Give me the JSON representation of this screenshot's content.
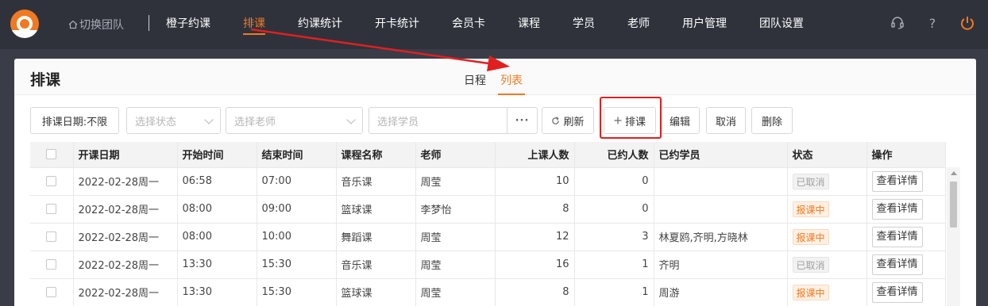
{
  "topbar": {
    "switch_team_label": "切换团队",
    "nav": [
      {
        "label": "橙子约课",
        "active": false
      },
      {
        "label": "排课",
        "active": true
      },
      {
        "label": "约课统计",
        "active": false
      },
      {
        "label": "开卡统计",
        "active": false
      },
      {
        "label": "会员卡",
        "active": false
      },
      {
        "label": "课程",
        "active": false
      },
      {
        "label": "学员",
        "active": false
      },
      {
        "label": "老师",
        "active": false
      },
      {
        "label": "用户管理",
        "active": false
      },
      {
        "label": "团队设置",
        "active": false
      }
    ],
    "icons": [
      "headset-icon",
      "help-icon",
      "power-icon"
    ],
    "help_glyph": "?"
  },
  "page": {
    "title": "排课",
    "view_tabs": [
      {
        "label": "日程",
        "active": false
      },
      {
        "label": "列表",
        "active": true
      }
    ]
  },
  "toolbar": {
    "date_filter": "排课日期:不限",
    "status_placeholder": "选择状态",
    "teacher_placeholder": "选择老师",
    "student_placeholder": "选择学员",
    "ellipsis": "···",
    "refresh_label": "刷新",
    "add_label": "排课",
    "edit_label": "编辑",
    "cancel_label": "取消",
    "delete_label": "删除"
  },
  "table": {
    "columns": [
      "开课日期",
      "开始时间",
      "结束时间",
      "课程名称",
      "老师",
      "上课人数",
      "已约人数",
      "已约学员",
      "状态",
      "操作"
    ],
    "rows": [
      {
        "date": "2022-02-28周一",
        "start": "06:58",
        "end": "07:00",
        "course": "音乐课",
        "teacher": "周莹",
        "capacity": "10",
        "booked": "0",
        "students": "",
        "status": "已取消",
        "status_type": "cancelled",
        "action": "查看详情"
      },
      {
        "date": "2022-02-28周一",
        "start": "08:00",
        "end": "09:00",
        "course": "篮球课",
        "teacher": "李梦怡",
        "capacity": "8",
        "booked": "0",
        "students": "",
        "status": "报课中",
        "status_type": "open",
        "action": "查看详情"
      },
      {
        "date": "2022-02-28周一",
        "start": "08:00",
        "end": "10:00",
        "course": "舞蹈课",
        "teacher": "周莹",
        "capacity": "12",
        "booked": "3",
        "students": "林夏鸥,齐明,方晓林",
        "status": "报课中",
        "status_type": "open",
        "action": "查看详情"
      },
      {
        "date": "2022-02-28周一",
        "start": "13:30",
        "end": "15:30",
        "course": "音乐课",
        "teacher": "周莹",
        "capacity": "16",
        "booked": "1",
        "students": "齐明",
        "status": "已取消",
        "status_type": "cancelled",
        "action": "查看详情"
      },
      {
        "date": "2022-02-28周一",
        "start": "13:30",
        "end": "15:30",
        "course": "篮球课",
        "teacher": "周莹",
        "capacity": "8",
        "booked": "1",
        "students": "周游",
        "status": "报课中",
        "status_type": "open",
        "action": "查看详情"
      }
    ]
  },
  "colors": {
    "accent": "#f07a22",
    "annotation": "#e02020",
    "nav_bg": "#2f323b"
  }
}
